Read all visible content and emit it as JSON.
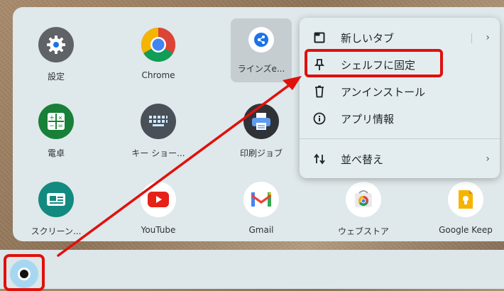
{
  "apps": [
    {
      "id": "settings",
      "label": "設定",
      "icon": "gear-icon",
      "color": "#5f6368"
    },
    {
      "id": "chrome",
      "label": "Chrome",
      "icon": "chrome-icon",
      "color": "#4285f4"
    },
    {
      "id": "lens",
      "label": "ラインズe...",
      "icon": "share-molecule-icon",
      "color": "#1a73e8"
    },
    {
      "id": "calculator",
      "label": "電卓",
      "icon": "calculator-icon",
      "color": "#188038"
    },
    {
      "id": "keyboard",
      "label": "キー ショー...",
      "icon": "keyboard-icon",
      "color": "#4a5057"
    },
    {
      "id": "print",
      "label": "印刷ジョブ",
      "icon": "printer-icon",
      "color": "#2f3337"
    },
    {
      "id": "screencast",
      "label": "スクリーン...",
      "icon": "screencast-icon",
      "color": "#128a7f"
    },
    {
      "id": "youtube",
      "label": "YouTube",
      "icon": "youtube-icon",
      "color": "#e62117"
    },
    {
      "id": "gmail",
      "label": "Gmail",
      "icon": "gmail-icon",
      "color": "#ea4335"
    },
    {
      "id": "webstore",
      "label": "ウェブストア",
      "icon": "webstore-icon",
      "color": "#4285f4"
    },
    {
      "id": "keep",
      "label": "Google Keep",
      "icon": "keep-icon",
      "color": "#f6b400"
    }
  ],
  "context_menu": {
    "items": [
      {
        "label": "新しいタブ",
        "icon": "new-tab-icon",
        "has_submenu": true
      },
      {
        "label": "シェルフに固定",
        "icon": "pin-icon",
        "highlighted": true
      },
      {
        "label": "アンインストール",
        "icon": "trash-icon"
      },
      {
        "label": "アプリ情報",
        "icon": "info-icon"
      },
      {
        "label": "並べ替え",
        "icon": "sort-icon",
        "has_submenu": true
      }
    ],
    "chevron": "›"
  },
  "highlight_color": "#e0100c"
}
